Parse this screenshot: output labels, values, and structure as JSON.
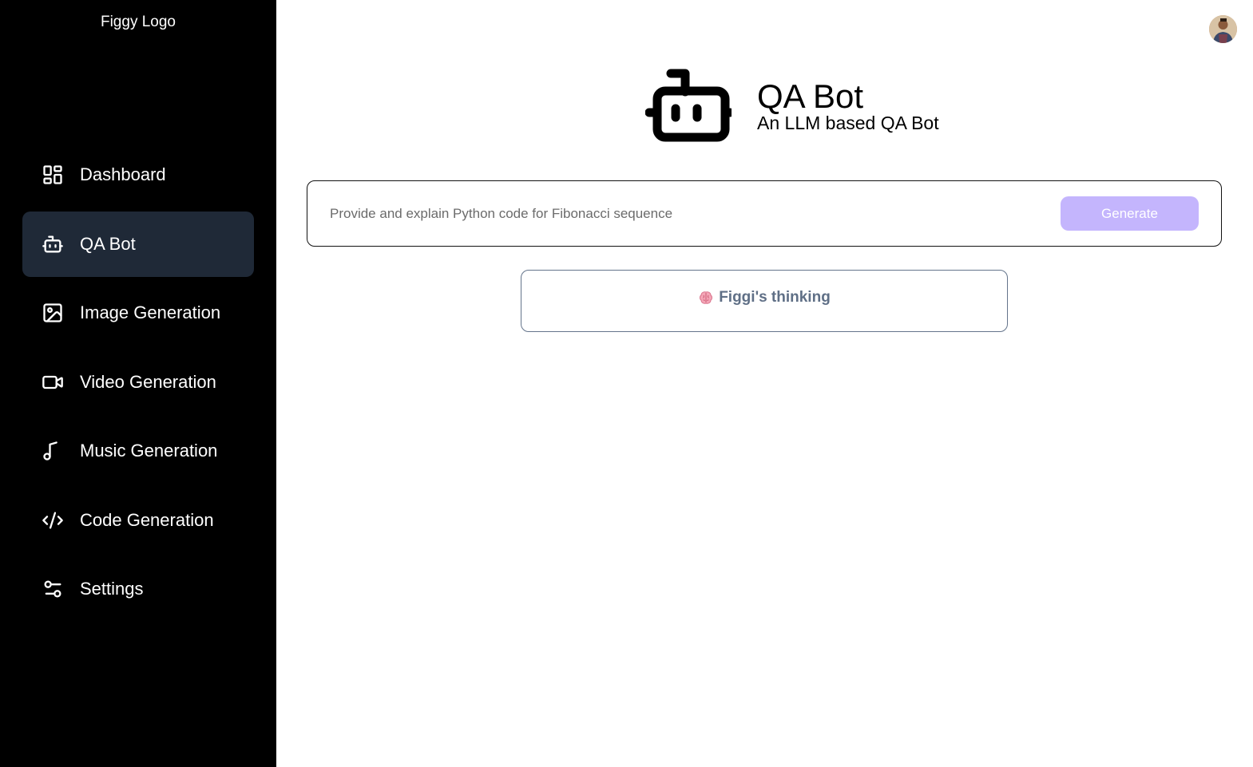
{
  "sidebar": {
    "logo": "Figgy Logo",
    "items": [
      {
        "label": "Dashboard",
        "icon": "dashboard-icon",
        "active": false
      },
      {
        "label": "QA Bot",
        "icon": "bot-icon",
        "active": true
      },
      {
        "label": "Image Generation",
        "icon": "image-icon",
        "active": false
      },
      {
        "label": "Video Generation",
        "icon": "video-icon",
        "active": false
      },
      {
        "label": "Music Generation",
        "icon": "music-icon",
        "active": false
      },
      {
        "label": "Code Generation",
        "icon": "code-icon",
        "active": false
      },
      {
        "label": "Settings",
        "icon": "settings-icon",
        "active": false
      }
    ]
  },
  "header": {
    "icon": "bot-icon",
    "title": "QA Bot",
    "subtitle": "An LLM based QA Bot"
  },
  "prompt": {
    "value": "",
    "placeholder": "Provide and explain Python code for Fibonacci sequence",
    "button_label": "Generate"
  },
  "thinking": {
    "icon": "brain-icon",
    "text": "Figgi's thinking"
  },
  "colors": {
    "sidebar_bg": "#000000",
    "active_item_bg": "#1f2937",
    "button_bg": "#c4b5fd",
    "thinking_text": "#5f6f86"
  }
}
